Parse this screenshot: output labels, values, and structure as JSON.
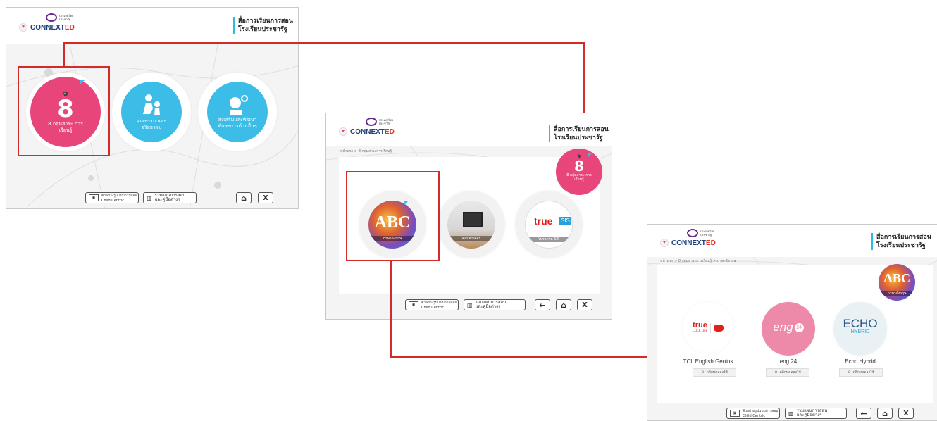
{
  "brand": {
    "logo_small_1": "ประเทศไทย",
    "logo_small_2": "ประชารัฐ",
    "logo_main": "CONNEXT",
    "logo_main_suffix": "ED",
    "title_line1": "สื่อการเรียนการสอน",
    "title_line2": "โรงเรียนประชารัฐ"
  },
  "screen1": {
    "circles": [
      {
        "label": "8 กลุ่มสาระ การเรียนรู้",
        "icon": "8"
      },
      {
        "label": "คุณธรรม และ จริยธรรม",
        "icon": "teacher-child-icon"
      },
      {
        "label": "ส่งเสริมและพัฒนา ทักษะการด้านอื่นๆ",
        "icon": "skills-icon"
      }
    ]
  },
  "screen2": {
    "breadcrumb": "หน้าแรก > 8 กลุ่มสาระการเรียนรู้",
    "badge_label": "8 กลุ่มสาระ การเรียนรู้",
    "items": [
      {
        "label": "ภาษาอังกฤษ",
        "art": "ABC"
      },
      {
        "label": "คอมพิวเตอร์",
        "art": "computer"
      },
      {
        "label": "โปรแกรม SIS",
        "art": "true SIS"
      }
    ]
  },
  "screen3": {
    "breadcrumb": "หน้าแรก > 8 กลุ่มสาระการเรียนรู้ > ภาษาอังกฤษ",
    "badge_label": "ภาษาอังกฤษ",
    "providers": [
      {
        "name": "TCL English Genius",
        "logo_text": "true",
        "logo_sub": "CLICK LIFE",
        "button": "คลิกทดลองใช้"
      },
      {
        "name": "eng 24",
        "logo_text": "eng",
        "logo_num": "24",
        "button": "คลิกทดลองใช้"
      },
      {
        "name": "Echo Hybrid",
        "logo_text": "ECHO",
        "logo_sub": "HYBRID",
        "button": "คลิกทดลองใช้"
      }
    ]
  },
  "footer": {
    "btn1_line1": "ตัวอย่างรูปแบบการสอน",
    "btn1_line2": "Child Centric",
    "btn2_line1": "รวมแผนการสอน",
    "btn2_line2": "และคู่มือต่างๆ",
    "home_icon": "⌂",
    "close_label": "X",
    "back_icon": "←"
  },
  "colors": {
    "pink": "#e8457a",
    "cyan": "#3cbde8",
    "red": "#d42a2a",
    "navy": "#1d3f7a"
  }
}
